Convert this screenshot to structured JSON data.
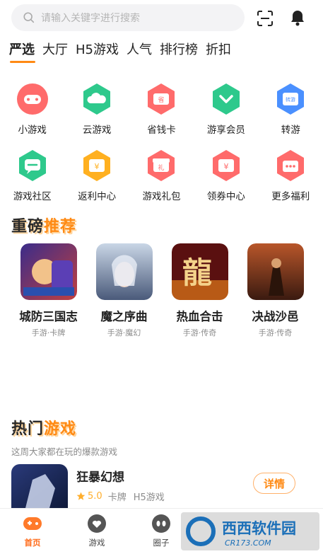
{
  "search": {
    "placeholder": "请输入关键字进行搜索",
    "icon": "search-icon"
  },
  "header_icons": [
    "scan-icon",
    "bell-icon"
  ],
  "tabs": [
    "严选",
    "大厅",
    "H5游戏",
    "人气",
    "排行榜",
    "折扣"
  ],
  "active_tab": "严选",
  "shortcuts": [
    {
      "label": "小游戏",
      "icon": "gamepad-icon",
      "color": "#ff6b6b"
    },
    {
      "label": "云游戏",
      "icon": "cloud-game-icon",
      "color": "#2ec98c"
    },
    {
      "label": "省钱卡",
      "icon": "save-card-icon",
      "color": "#ff6b6b"
    },
    {
      "label": "游享会员",
      "icon": "member-icon",
      "color": "#2ec98c"
    },
    {
      "label": "转游",
      "icon": "transfer-icon",
      "color": "#4a90ff"
    },
    {
      "label": "游戏社区",
      "icon": "community-icon",
      "color": "#2ec98c"
    },
    {
      "label": "返利中心",
      "icon": "rebate-icon",
      "color": "#ffb020"
    },
    {
      "label": "游戏礼包",
      "icon": "gift-icon",
      "color": "#ff6b6b"
    },
    {
      "label": "领券中心",
      "icon": "coupon-icon",
      "color": "#ff6b6b"
    },
    {
      "label": "更多福利",
      "icon": "more-welfare-icon",
      "color": "#ff6b6b"
    }
  ],
  "featured": {
    "title_a": "重磅",
    "title_b": "推荐"
  },
  "games": [
    {
      "name": "城防三国志",
      "tags": "手游·卡牌"
    },
    {
      "name": "魔之序曲",
      "tags": "手游·魔幻"
    },
    {
      "name": "热血合击",
      "tags": "手游·传奇"
    },
    {
      "name": "决战沙邑",
      "tags": "手游·传奇"
    }
  ],
  "hot": {
    "title_a": "热门",
    "title_b": "游戏",
    "subtitle": "这周大家都在玩的爆款游戏",
    "item": {
      "name": "狂暴幻想",
      "rating": "5.0",
      "tag1": "卡牌",
      "tag2": "H5游戏",
      "button": "详情"
    }
  },
  "bottom_nav": [
    {
      "label": "首页",
      "icon": "home-gamepad-icon",
      "active": true
    },
    {
      "label": "游戏",
      "icon": "game-heart-icon",
      "active": false
    },
    {
      "label": "圈子",
      "icon": "circle-icon",
      "active": false
    }
  ],
  "colors": {
    "accent": "#ff8a14",
    "text": "#222222",
    "muted": "#8c8c8c"
  }
}
